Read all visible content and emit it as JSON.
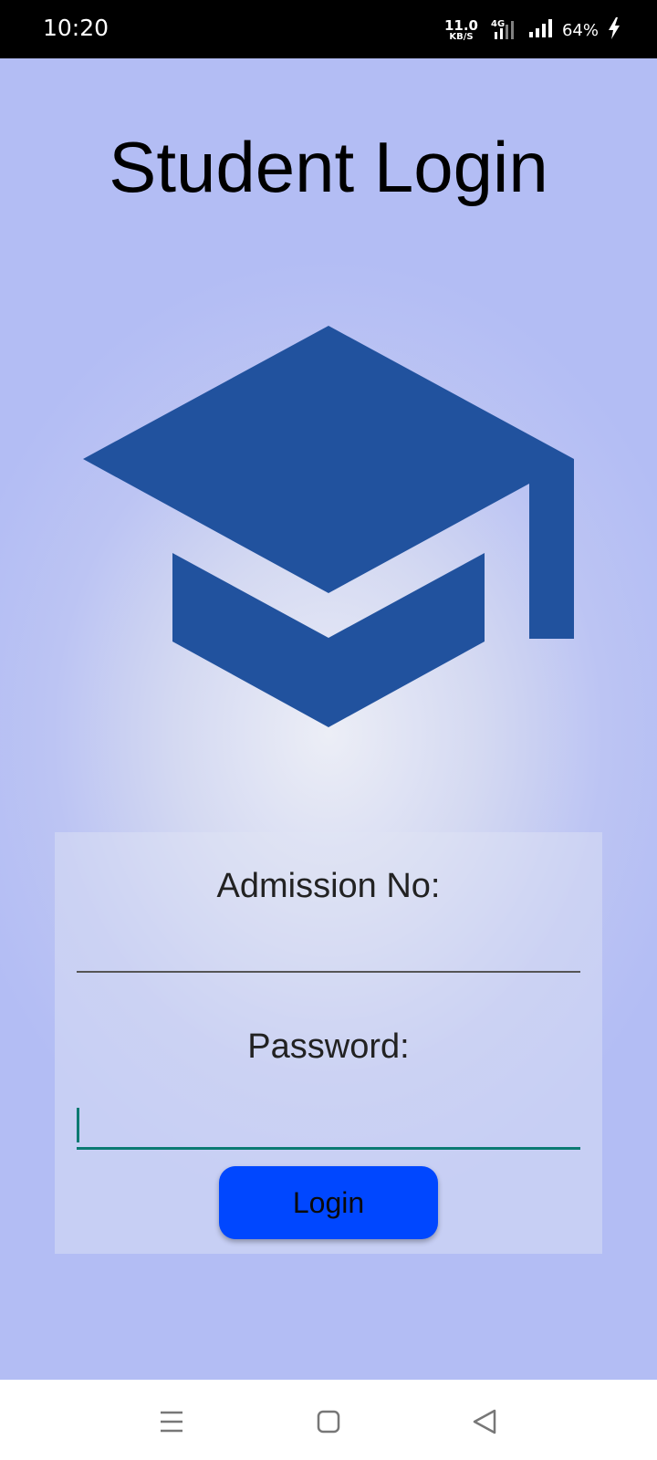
{
  "status_bar": {
    "time": "10:20",
    "net_speed_value": "11.0",
    "net_speed_unit": "KB/S",
    "network_type": "4G",
    "battery": "64%",
    "icons": [
      "volte-4g-signal-icon",
      "cell-signal-icon",
      "charging-bolt-icon"
    ]
  },
  "page": {
    "title": "Student Login",
    "logo_icon": "graduation-cap-icon",
    "logo_color": "#21529e",
    "background_color": "#b3bdf4"
  },
  "form": {
    "admission_label": "Admission No:",
    "admission_value": "",
    "password_label": "Password:",
    "password_value": "",
    "login_button_label": "Login",
    "button_color": "#0047ff",
    "focus_color": "#0b7a72"
  },
  "nav_bar": {
    "icons": [
      "menu-icon",
      "home-square-icon",
      "back-triangle-icon"
    ]
  }
}
